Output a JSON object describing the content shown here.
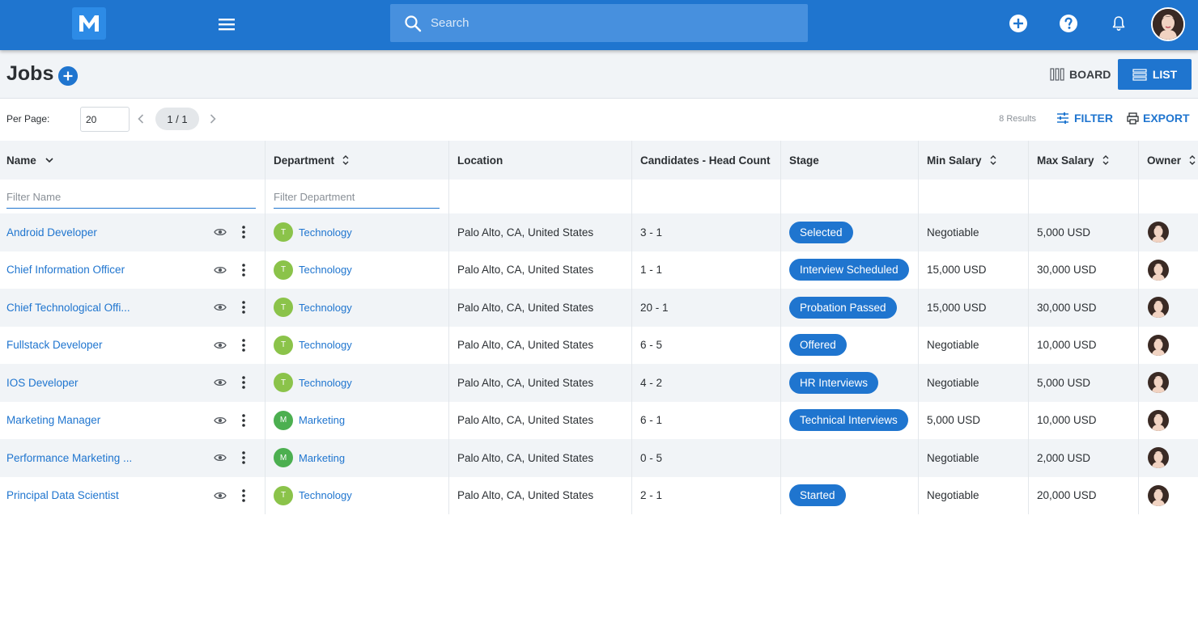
{
  "app": {
    "logo_letter": "M",
    "brand_color": "#1f75cf"
  },
  "topbar": {
    "search_placeholder": "Search",
    "icons": [
      "menu-icon",
      "search-icon",
      "add-circle-icon",
      "help-icon",
      "bell-icon",
      "user-avatar"
    ]
  },
  "header": {
    "title": "Jobs",
    "board_label": "BOARD",
    "list_label": "LIST"
  },
  "pager": {
    "per_page_label": "Per Page:",
    "per_page_value": "20",
    "page": "1 / 1",
    "results": "8 Results",
    "filter_label": "FILTER",
    "export_label": "EXPORT"
  },
  "table": {
    "columns": {
      "name": "Name",
      "department": "Department",
      "location": "Location",
      "candidates": "Candidates - Head Count",
      "stage": "Stage",
      "min_salary": "Min Salary",
      "max_salary": "Max Salary",
      "owner": "Owner"
    },
    "filters": {
      "name_placeholder": "Filter Name",
      "department_placeholder": "Filter Department"
    },
    "rows": [
      {
        "name": "Android Developer",
        "dept_initial": "T",
        "department": "Technology",
        "location": "Palo Alto, CA, United States",
        "candidates": "3 - 1",
        "stage": "Selected",
        "min_salary": "Negotiable",
        "max_salary": "5,000 USD"
      },
      {
        "name": "Chief Information Officer",
        "dept_initial": "T",
        "department": "Technology",
        "location": "Palo Alto, CA, United States",
        "candidates": "1 - 1",
        "stage": "Interview Scheduled",
        "min_salary": "15,000 USD",
        "max_salary": "30,000 USD"
      },
      {
        "name": "Chief Technological Offi...",
        "dept_initial": "T",
        "department": "Technology",
        "location": "Palo Alto, CA, United States",
        "candidates": "20 - 1",
        "stage": "Probation Passed",
        "min_salary": "15,000 USD",
        "max_salary": "30,000 USD"
      },
      {
        "name": "Fullstack Developer",
        "dept_initial": "T",
        "department": "Technology",
        "location": "Palo Alto, CA, United States",
        "candidates": "6 - 5",
        "stage": "Offered",
        "min_salary": "Negotiable",
        "max_salary": "10,000 USD"
      },
      {
        "name": "IOS Developer",
        "dept_initial": "T",
        "department": "Technology",
        "location": "Palo Alto, CA, United States",
        "candidates": "4 - 2",
        "stage": "HR Interviews",
        "min_salary": "Negotiable",
        "max_salary": "5,000 USD"
      },
      {
        "name": "Marketing Manager",
        "dept_initial": "M",
        "department": "Marketing",
        "location": "Palo Alto, CA, United States",
        "candidates": "6 - 1",
        "stage": "Technical Interviews",
        "min_salary": "5,000 USD",
        "max_salary": "10,000 USD"
      },
      {
        "name": "Performance Marketing ...",
        "dept_initial": "M",
        "department": "Marketing",
        "location": "Palo Alto, CA, United States",
        "candidates": "0 - 5",
        "stage": "",
        "min_salary": "Negotiable",
        "max_salary": "2,000 USD"
      },
      {
        "name": "Principal Data Scientist",
        "dept_initial": "T",
        "department": "Technology",
        "location": "Palo Alto, CA, United States",
        "candidates": "2 - 1",
        "stage": "Started",
        "min_salary": "Negotiable",
        "max_salary": "20,000 USD"
      }
    ]
  },
  "colors": {
    "technology_badge": "#8bc34a",
    "marketing_badge": "#4caf50",
    "stage_pill": "#1f75cf",
    "link": "#1f75cf"
  }
}
